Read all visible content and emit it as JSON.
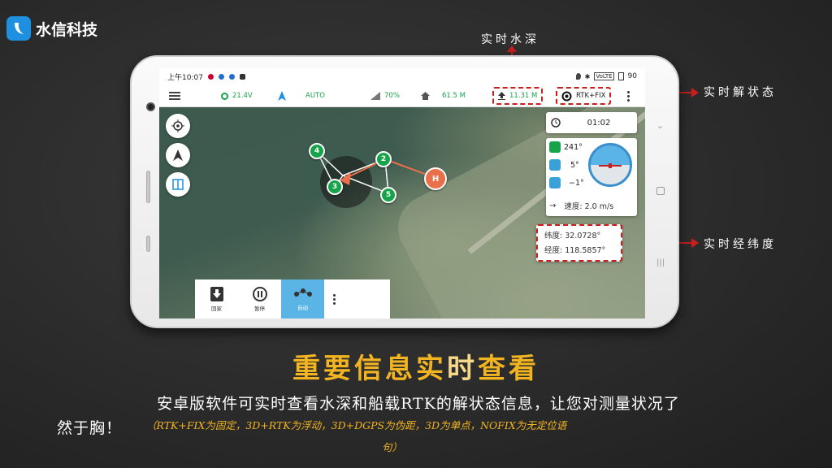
{
  "brand": {
    "name": "水信科技"
  },
  "callouts": {
    "water_depth": "实时水深",
    "solution_status": "实时解状态",
    "lat_lon": "实时经纬度"
  },
  "statusbar": {
    "time": "上午10:07",
    "battery": "90",
    "network": "VoLTE"
  },
  "toolbar": {
    "voltage": "21.4V",
    "mode": "AUTO",
    "signal": "70%",
    "home_distance": "61.5 M",
    "depth": "11.31 M",
    "rtk_status": "RTK+FIX"
  },
  "timer": {
    "value": "01:02"
  },
  "attitude": {
    "heading": "241°",
    "pitch": "5°",
    "roll": "−1°",
    "speed": "速度: 2.0 m/s"
  },
  "position": {
    "latitude": "纬度: 32.0728°",
    "longitude": "经度: 118.5857°"
  },
  "waypoints": [
    "4",
    "2",
    "3",
    "5"
  ],
  "home_marker": "H",
  "bottom_bar": {
    "return_label": "回家",
    "pause_label": "暂停",
    "auto_label": "自动"
  },
  "headline": {
    "part1": "重要信息实",
    "part2": "时",
    "part3": "查看"
  },
  "description": {
    "line1": "安卓版软件可实时查看水深和船载RTK的解状态信息，让您对测量状况了",
    "line2": "然于胸！",
    "note": "（RTK+FIX为固定，3D+RTK为浮动，3D+DGPS为伪距，3D为单点，NOFIX为无定位语",
    "note_wrap": "句）"
  },
  "colors": {
    "accent_green": "#16a34a",
    "highlight_red": "#c81e1e",
    "headline_gold": "#f2b420",
    "active_blue": "#5ab4e6",
    "home_orange": "#e8704a"
  }
}
